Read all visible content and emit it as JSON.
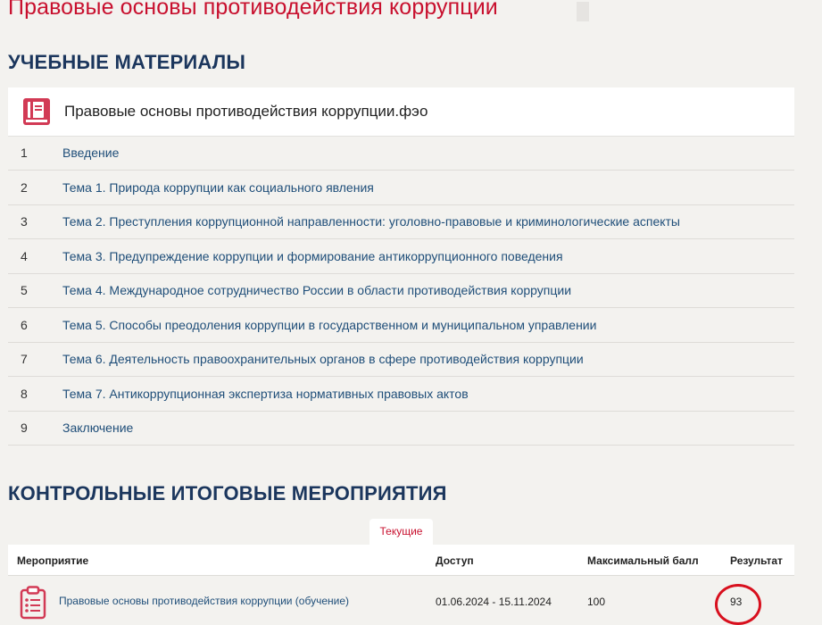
{
  "page": {
    "title": "Правовые основы противодействия коррупции"
  },
  "materials": {
    "heading": "УЧЕБНЫЕ МАТЕРИАЛЫ",
    "card_title": "Правовые основы противодействия коррупции.фэо",
    "icon": "book-icon",
    "lessons": [
      {
        "num": "1",
        "title": "Введение"
      },
      {
        "num": "2",
        "title": "Тема 1. Природа коррупции как социального явления"
      },
      {
        "num": "3",
        "title": "Тема 2. Преступления коррупционной направленности: уголовно-правовые и криминологические аспекты"
      },
      {
        "num": "4",
        "title": "Тема 3. Предупреждение коррупции и формирование антикоррупционного поведения"
      },
      {
        "num": "5",
        "title": "Тема 4. Международное сотрудничество России в области противодействия коррупции"
      },
      {
        "num": "6",
        "title": "Тема 5. Способы преодоления коррупции в государственном и муниципальном управлении"
      },
      {
        "num": "7",
        "title": "Тема 6. Деятельность правоохранительных органов в сфере противодействия коррупции"
      },
      {
        "num": "8",
        "title": "Тема 7. Антикоррупционная экспертиза нормативных правовых актов"
      },
      {
        "num": "9",
        "title": "Заключение"
      }
    ]
  },
  "events": {
    "heading": "КОНТРОЛЬНЫЕ ИТОГОВЫЕ МЕРОПРИЯТИЯ",
    "tab_current": "Текущие",
    "columns": {
      "event": "Мероприятие",
      "access": "Доступ",
      "max_score": "Максимальный балл",
      "result": "Результат"
    },
    "rows": [
      {
        "icon": "clipboard-icon",
        "event": "Правовые основы противодействия коррупции (обучение)",
        "access": "01.06.2024 - 15.11.2024",
        "max_score": "100",
        "result": "93"
      }
    ]
  },
  "colors": {
    "accent_red": "#c8102e",
    "heading_navy": "#1b365d",
    "link_blue": "#1f4e79",
    "background": "#f3f2ef"
  }
}
